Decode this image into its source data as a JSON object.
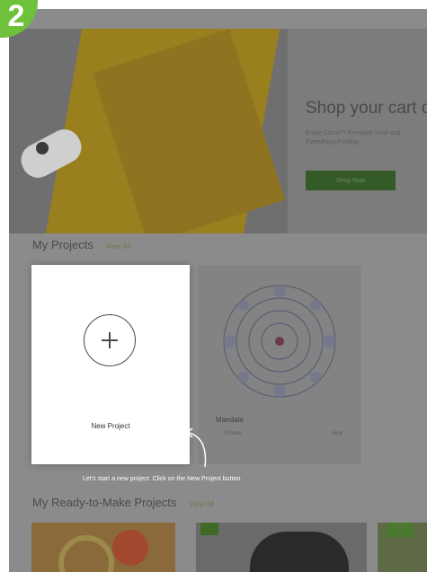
{
  "step_badge": {
    "number": "2",
    "color": "#6ec13b"
  },
  "hero": {
    "title": "Shop your cart o",
    "subtitle": "Enjoy Cricut™ Premium Vinyl and Everything Printing",
    "button_label": "Shop Now"
  },
  "my_projects": {
    "title": "My Projects",
    "view_all": "View All",
    "new_project_label": "New Project",
    "icon": "plus-circle-icon",
    "project_card": {
      "name": "Mandala",
      "meta_left": "Private",
      "meta_right": "View"
    }
  },
  "instruction": "Let's start a new project. Click on the New Project button.",
  "ready_to_make": {
    "title": "My Ready-to-Make Projects",
    "view_all": "View All"
  }
}
